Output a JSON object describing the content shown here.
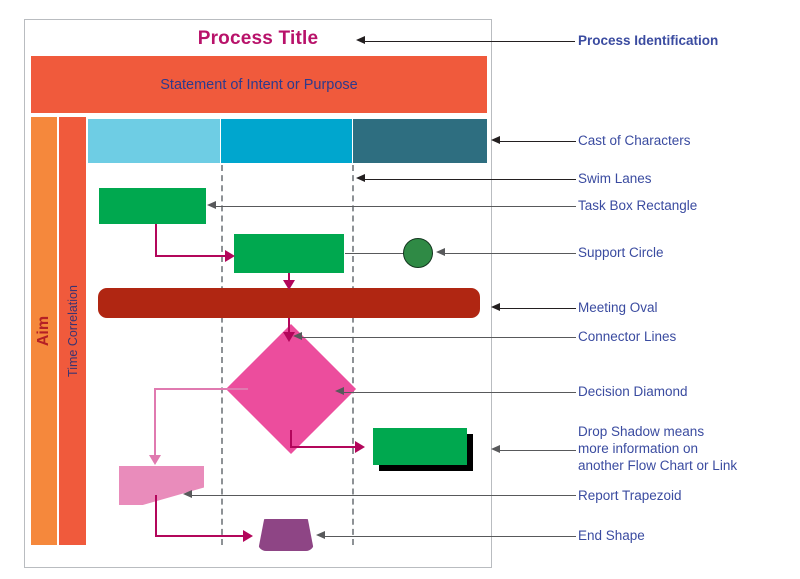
{
  "diagram": {
    "title": "Process Title",
    "statement": "Statement of Intent or Purpose",
    "vertical_axes": {
      "aim": "Aim",
      "time_correlation": "Time Correlation"
    },
    "swimlanes": [
      {
        "name": "lane-1",
        "label": "",
        "color": "#6ecde4"
      },
      {
        "name": "lane-2",
        "label": "",
        "color": "#00a6ce"
      },
      {
        "name": "lane-3",
        "label": "",
        "color": "#2e6e80"
      }
    ],
    "shapes": [
      {
        "name": "task-box-1",
        "type": "rectangle",
        "label": "",
        "color": "#00a84f"
      },
      {
        "name": "task-box-2",
        "type": "rectangle",
        "label": "",
        "color": "#00a84f"
      },
      {
        "name": "support-circle",
        "type": "circle",
        "label": "",
        "color": "#2f8a45"
      },
      {
        "name": "meeting-oval",
        "type": "rounded-bar",
        "label": "",
        "color": "#b02612"
      },
      {
        "name": "decision-diamond",
        "type": "diamond",
        "label": "",
        "color": "#ec4d9d"
      },
      {
        "name": "drop-shadow-box",
        "type": "rectangle",
        "label": "",
        "color": "#00a84f"
      },
      {
        "name": "report-trapezoid",
        "type": "trapezoid",
        "label": "",
        "color": "#e98cbb"
      },
      {
        "name": "end-shape",
        "type": "trapezoid",
        "label": "",
        "color": "#8e4585"
      }
    ],
    "colors": {
      "title_text": "#b8126a",
      "statement_bg": "#f05a3c",
      "statement_text": "#2e3a8c",
      "aim_bg": "#f5883c",
      "aim_text": "#b52025",
      "time_bg": "#f05a3c",
      "time_text": "#3b3472",
      "callout_text": "#3a4ba0",
      "connector_magenta": "#b3065b",
      "connector_pink": "#e07ab0",
      "leader_line": "#58595b",
      "frame_border": "#b9bcc0"
    }
  },
  "callouts": [
    {
      "name": "process-identification",
      "label": "Process Identification"
    },
    {
      "name": "cast-of-characters",
      "label": "Cast of Characters"
    },
    {
      "name": "swim-lanes",
      "label": "Swim Lanes"
    },
    {
      "name": "task-box-rectangle",
      "label": "Task Box Rectangle"
    },
    {
      "name": "support-circle",
      "label": "Support Circle"
    },
    {
      "name": "meeting-oval",
      "label": "Meeting Oval"
    },
    {
      "name": "connector-lines",
      "label": "Connector Lines"
    },
    {
      "name": "decision-diamond",
      "label": "Decision Diamond"
    },
    {
      "name": "drop-shadow",
      "label_line_1": "Drop Shadow means",
      "label_line_2": "more information on",
      "label_line_3": "another Flow Chart or Link"
    },
    {
      "name": "report-trapezoid",
      "label": "Report Trapezoid"
    },
    {
      "name": "end-shape",
      "label": "End Shape"
    }
  ]
}
